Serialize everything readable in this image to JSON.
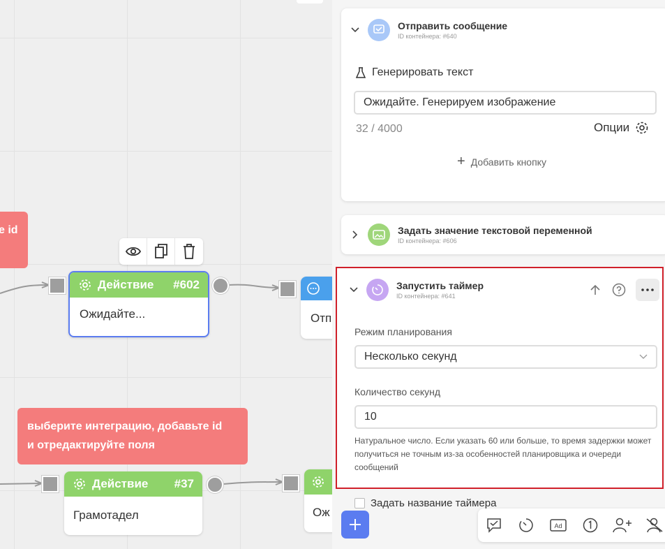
{
  "canvas": {
    "note_top_fragment": "e id",
    "note_bottom": [
      "выберите интеграцию, добавьте id",
      "и отредактируйте поля"
    ],
    "node1": {
      "title": "Действие",
      "id": "#602",
      "body": "Ожидайте..."
    },
    "node2_fragment": "Отп",
    "node3": {
      "title": "Действие",
      "id": "#37",
      "body": "Грамотадел"
    },
    "node4_fragment": "Ож"
  },
  "panel": {
    "card1": {
      "title": "Отправить сообщение",
      "container_id": "ID контейнера: #640",
      "generate_label": "Генерировать текст",
      "message_value": "Ожидайте. Генерируем изображение",
      "char_count": "32 / 4000",
      "options_label": "Опции",
      "add_button_label": "Добавить кнопку"
    },
    "card2": {
      "title": "Задать значение текстовой переменной",
      "container_id": "ID контейнера: #606"
    },
    "card3": {
      "title": "Запустить таймер",
      "container_id": "ID контейнера: #641",
      "mode_label": "Режим планирования",
      "mode_value": "Несколько секунд",
      "seconds_label": "Количество секунд",
      "seconds_value": "10",
      "hint": "Натуральное число. Если указать 60 или больше, то время задержки может получиться не точным из-за особенностей планировщика и очереди сообщений"
    },
    "timer_name_label": "Задать название таймера"
  },
  "colors": {
    "accent_blue": "#5b7cf0",
    "action_green": "#8fd36a",
    "error_red": "#f47c7c",
    "highlight_border": "#d0202a"
  }
}
